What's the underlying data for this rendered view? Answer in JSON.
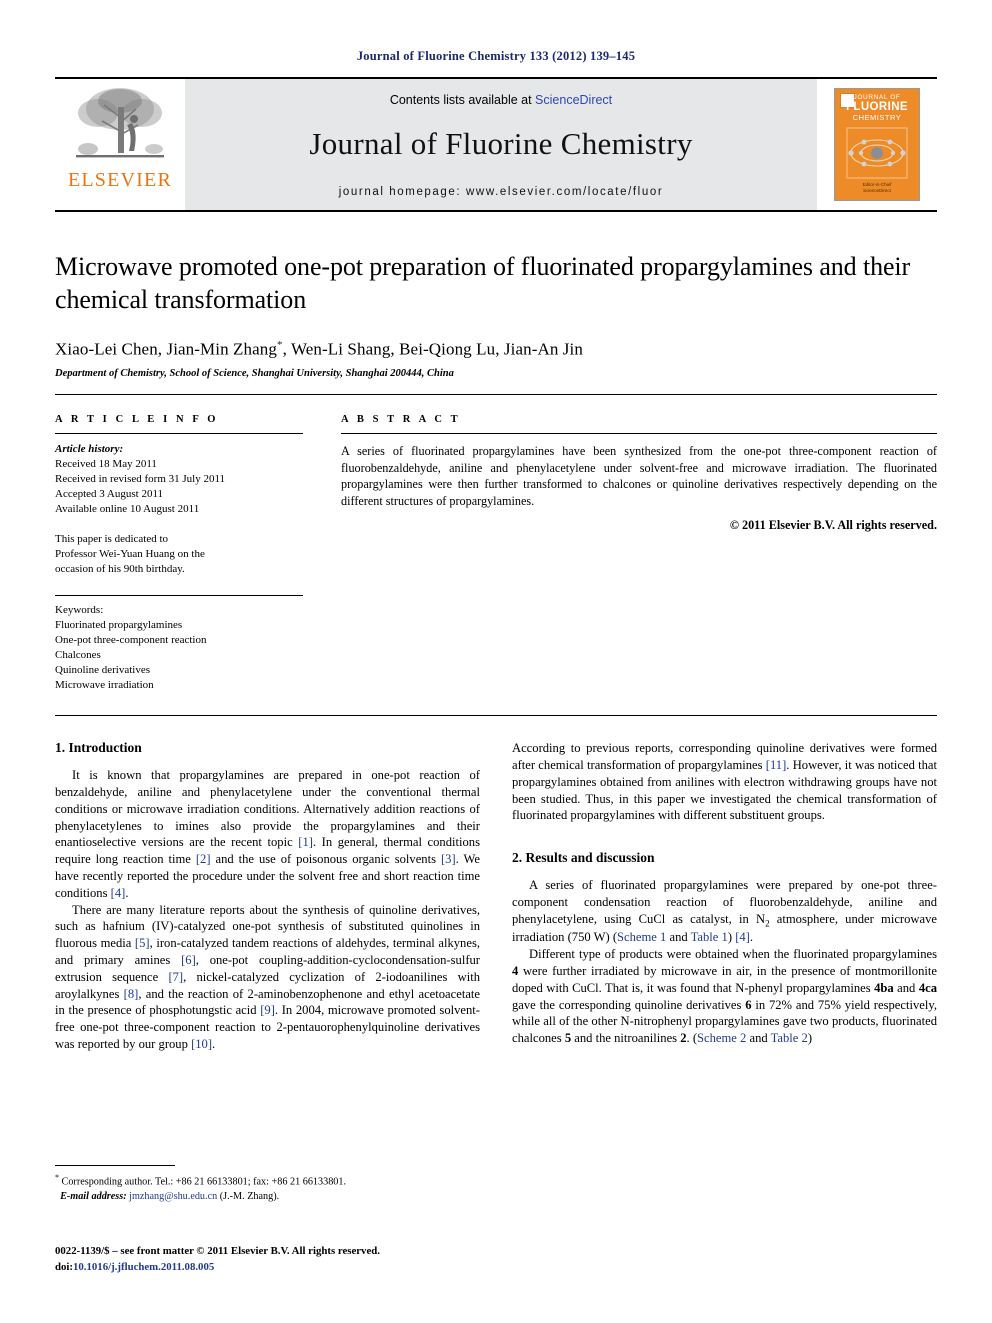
{
  "running_head": "Journal of Fluorine Chemistry 133 (2012) 139–145",
  "masthead": {
    "publisher_logo_text": "ELSEVIER",
    "contents_prefix": "Contents lists available at ",
    "contents_link": "ScienceDirect",
    "journal_title": "Journal of Fluorine Chemistry",
    "homepage": "journal homepage: www.elsevier.com/locate/fluor",
    "cover": {
      "line1": "JOURNAL OF",
      "line2": "FLUORINE",
      "line3": "CHEMISTRY",
      "footer1": "Editor-in-Chief",
      "footer2": "ScienceDirect",
      "accent_color": "#ED8B28"
    }
  },
  "article": {
    "title": "Microwave promoted one-pot preparation of fluorinated propargylamines and their chemical transformation",
    "authors": "Xiao-Lei Chen, Jian-Min Zhang",
    "authors_rest": ", Wen-Li Shang, Bei-Qiong Lu, Jian-An Jin",
    "corresponding_marker": "*",
    "affiliation": "Department of Chemistry, School of Science, Shanghai University, Shanghai 200444, China"
  },
  "article_info": {
    "heading": "A R T I C L E    I N F O",
    "history_label": "Article history:",
    "history": [
      "Received 18 May 2011",
      "Received in revised form 31 July 2011",
      "Accepted 3 August 2011",
      "Available online 10 August 2011"
    ],
    "dedication": [
      "This paper is dedicated to",
      "Professor Wei-Yuan Huang on the",
      "occasion of his 90th birthday."
    ],
    "keywords_label": "Keywords:",
    "keywords": [
      "Fluorinated propargylamines",
      "One-pot three-component reaction",
      "Chalcones",
      "Quinoline derivatives",
      "Microwave irradiation"
    ]
  },
  "abstract": {
    "heading": "A B S T R A C T",
    "text": "A series of fluorinated propargylamines have been synthesized from the one-pot three-component reaction of fluorobenzaldehyde, aniline and phenylacetylene under solvent-free and microwave irradiation. The fluorinated propargylamines were then further transformed to chalcones or quinoline derivatives respectively depending on the different structures of propargylamines.",
    "copyright": "© 2011 Elsevier B.V. All rights reserved."
  },
  "sections": {
    "intro_heading": "1. Introduction",
    "results_heading": "2. Results and discussion"
  },
  "body": {
    "p1_a": "It is known that propargylamines are prepared in one-pot reaction of benzaldehyde, aniline and phenylacetylene under the conventional thermal conditions or microwave irradiation conditions. Alternatively addition reactions of phenylacetylenes to imines also provide the propargylamines and their enantioselective versions are the recent topic ",
    "p1_r1": "[1]",
    "p1_b": ". In general, thermal conditions require long reaction time ",
    "p1_r2": "[2]",
    "p1_c": " and the use of poisonous organic solvents ",
    "p1_r3": "[3]",
    "p1_d": ". We have recently reported the procedure under the solvent free and short reaction time conditions ",
    "p1_r4": "[4]",
    "p1_e": ".",
    "p2_a": "There are many literature reports about the synthesis of quinoline derivatives, such as hafnium (IV)-catalyzed one-pot synthesis of substituted quinolines in fluorous media ",
    "p2_r5": "[5]",
    "p2_b": ", iron-catalyzed tandem reactions of aldehydes, terminal alkynes, and primary amines ",
    "p2_r6": "[6]",
    "p2_c": ", one-pot coupling-addition-cyclocondensation-sulfur extrusion sequence ",
    "p2_r7": "[7]",
    "p2_d": ", nickel-catalyzed cyclization of 2-iodoanilines with aroylalkynes ",
    "p2_r8": "[8]",
    "p2_e": ", and the reaction of 2-aminobenzophenone and ethyl acetoacetate in the presence of phosphotungstic acid ",
    "p2_r9": "[9]",
    "p2_f": ". In 2004, microwave promoted solvent-free one-pot three-component reaction to 2-pentauorophenylquinoline derivatives was reported by our group ",
    "p2_r10": "[10]",
    "p2_g": ".",
    "p3_a": "According to previous reports, corresponding quinoline derivatives were formed after chemical transformation of propargylamines ",
    "p3_r11": "[11]",
    "p3_b": ". However, it was noticed that propargylamines obtained from anilines with electron withdrawing groups have not been studied. Thus, in this paper we investigated the chemical transformation of fluorinated propargylamines with different substituent groups.",
    "p4_a": "A series of fluorinated propargylamines were prepared by one-pot three-component condensation reaction of fluorobenzaldehyde, aniline and phenylacetylene, using CuCl as catalyst, in N",
    "p4_sub": "2",
    "p4_b": " atmosphere, under microwave irradiation (750 W) (",
    "p4_link1": "Scheme 1",
    "p4_c": " and ",
    "p4_link2": "Table 1",
    "p4_d": ") ",
    "p4_r4": "[4]",
    "p4_e": ".",
    "p5_a": "Different type of products were obtained when the fluorinated propargylamines ",
    "p5_b4": "4",
    "p5_b": " were further irradiated by microwave in air, in the presence of montmorillonite doped with CuCl. That is, it was found that N-phenyl propargylamines ",
    "p5_b4ba": "4ba",
    "p5_c": " and ",
    "p5_b4ca": "4ca",
    "p5_d": " gave the corresponding quinoline derivatives ",
    "p5_b6": "6",
    "p5_e": " in 72% and 75% yield respectively, while all of the other N-nitrophenyl propargylamines gave two products, fluorinated chalcones ",
    "p5_b5": "5",
    "p5_f": " and the nitroanilines ",
    "p5_b2": "2",
    "p5_g": ". (",
    "p5_link1": "Scheme 2",
    "p5_h": " and ",
    "p5_link2": "Table 2",
    "p5_i": ")"
  },
  "footnote": {
    "marker": "*",
    "text": " Corresponding author. Tel.: +86 21 66133801; fax: +86 21 66133801.",
    "email_label": "E-mail address:",
    "email": "jmzhang@shu.edu.cn",
    "email_suffix": " (J.-M. Zhang)."
  },
  "footer": {
    "issn_line": "0022-1139/$ – see front matter © 2011 Elsevier B.V. All rights reserved.",
    "doi_label": "doi:",
    "doi": "10.1016/j.jfluchem.2011.08.005"
  }
}
